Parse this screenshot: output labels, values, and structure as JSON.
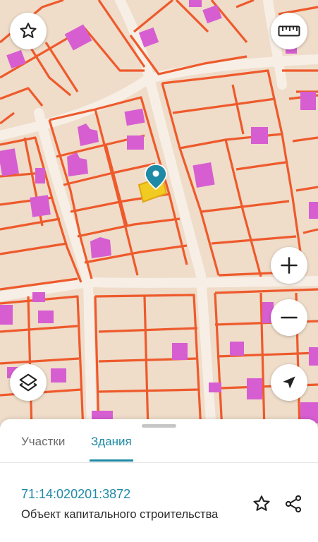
{
  "map": {
    "background_color": "#efdcc9",
    "road_color": "#f6eee5",
    "parcel_border_color": "#ef5a2c",
    "building_color": "#d45fd0",
    "selected_building_color": "#f2cc22",
    "marker_color": "#1f8aa5"
  },
  "controls": {
    "favorite_icon": "star-outline-icon",
    "ruler_icon": "ruler-icon",
    "zoom_in_icon": "plus-icon",
    "zoom_out_icon": "minus-icon",
    "layers_icon": "layers-icon",
    "locate_icon": "navigation-arrow-icon"
  },
  "panel": {
    "tabs": [
      {
        "label": "Участки",
        "active": false
      },
      {
        "label": "Здания",
        "active": true
      }
    ],
    "cadastral_number": "71:14:020201:3872",
    "object_type": "Объект капитального строительства",
    "accent_color": "#1f8aa5"
  }
}
